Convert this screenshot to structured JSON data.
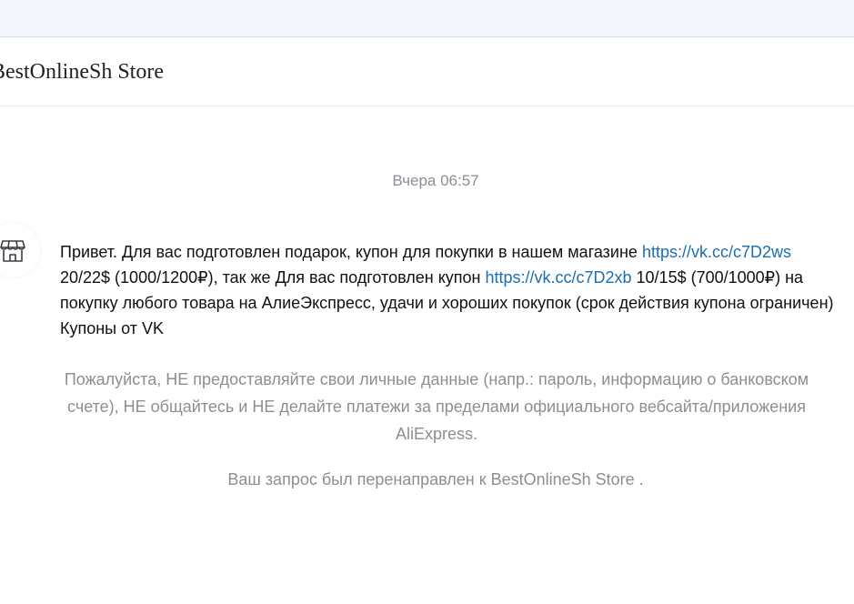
{
  "header": {
    "store_name": "BestOnlineSh Store"
  },
  "chat": {
    "timestamp": "Вчера 06:57",
    "avatar_icon": "store-icon",
    "message": {
      "part1": "Привет. Для вас подготовлен подарок, купон для покупки в нашем магазине ",
      "link1": "https://vk.cc/c7D2ws",
      "part2": " 20/22$ (1000/1200₽), так же Для вас подготовлен купон ",
      "link2": "https://vk.cc/c7D2xb",
      "part3": " 10/15$ (700/1000₽) на покупку любого товара на АлиеЭкспресс, удачи и хороших покупок (срок действия купона ограничен) Купоны от VK"
    },
    "warning": "Пожалуйста, НЕ предоставляйте свои личные данные (напр.: пароль, информацию о банковском счете), НЕ общайтесь и НЕ делайте платежи за пределами официального вебсайта/приложения AliExpress.",
    "redirect_notice": "Ваш запрос был перенаправлен к BestOnlineSh Store ."
  },
  "colors": {
    "link": "#1a6fb3",
    "muted_text": "#8a8f96",
    "primary_text": "#111111"
  }
}
